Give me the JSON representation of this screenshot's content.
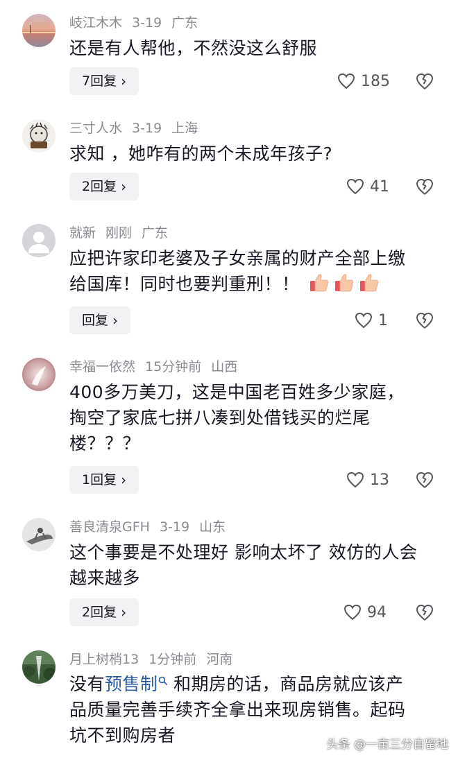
{
  "comments": [
    {
      "username": "岐江木木",
      "date": "3-19",
      "location": "广东",
      "text_lines": [
        "还是有人帮他，不然没这么舒服"
      ],
      "reply_label": "7回复",
      "likes": "185"
    },
    {
      "username": "三寸人水",
      "date": "3-19",
      "location": "上海",
      "text_lines": [
        "求知 ，她咋有的两个未成年孩子?"
      ],
      "reply_label": "2回复",
      "likes": "41"
    },
    {
      "username": "就新",
      "date": "刚刚",
      "location": "广东",
      "text_lines": [
        "应把许家印老婆及子女亲属的财产全部上缴",
        "给国库！同时也要判重刑！！"
      ],
      "reply_label": "回复",
      "likes": "1"
    },
    {
      "username": "幸福一依然",
      "date": "15分钟前",
      "location": "山西",
      "text_lines": [
        "400多万美刀，这是中国老百姓多少家庭，",
        "掏空了家底七拼八凑到处借钱买的烂尾",
        "楼？？？"
      ],
      "reply_label": "1回复",
      "likes": "13"
    },
    {
      "username": "善良清泉GFH",
      "date": "3-19",
      "location": "山东",
      "text_lines": [
        "这个事要是不处理好 影响太坏了 效仿的人会",
        "越来越多"
      ],
      "reply_label": "2回复",
      "likes": "94"
    },
    {
      "username": "月上树梢13",
      "date": "1分钟前",
      "location": "河南",
      "text_prefix": "没有",
      "text_link": "预售制",
      "text_after_link": " 和期房的话，商品房就应该产",
      "text_lines": [
        "品质量完善手续齐全拿出来现房销售。起码",
        "坑不到购房者"
      ]
    }
  ],
  "watermark": "头条 @一亩三分自留地",
  "colors": {
    "meta": "#8a8b91",
    "text": "#161823",
    "reply_bg": "#f2f2f4",
    "link": "#2a5aa5"
  },
  "icons": [
    "heart-outline-icon",
    "broken-heart-icon",
    "chevron-right-icon",
    "search-icon",
    "thumbs-up-emoji"
  ]
}
